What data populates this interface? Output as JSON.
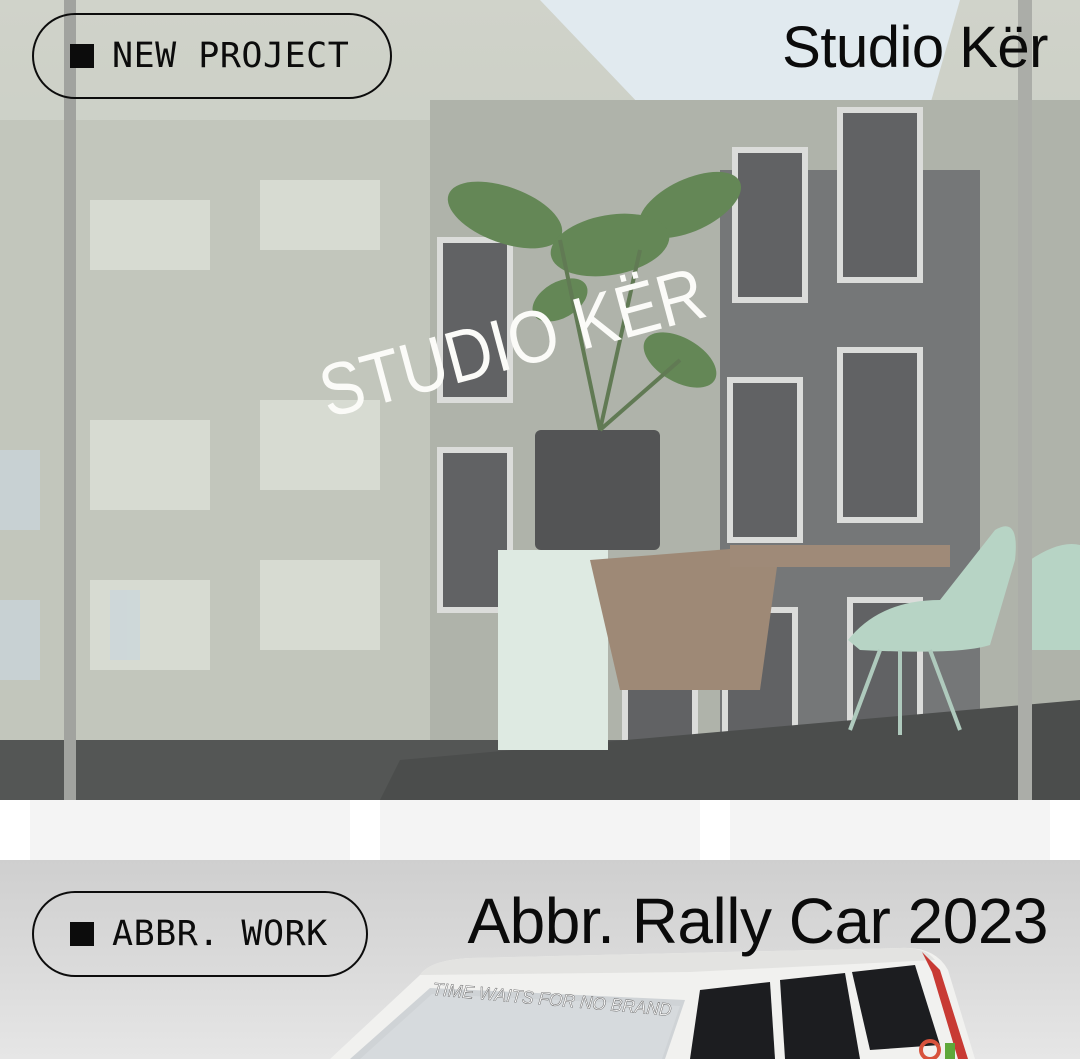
{
  "hero": {
    "cta_label": "NEW PROJECT",
    "brand": "Studio Kër",
    "window_sign": "STUDIO KËR",
    "image": "storefront-window-photo"
  },
  "project": {
    "category_label": "ABBR. WORK",
    "title": "Abbr. Rally Car 2023",
    "car_slogan": "TIME WAITS FOR NO BRAND",
    "image": "rally-car-photo"
  },
  "colors": {
    "ink": "#0c0c0c",
    "page_bg": "#ffffff",
    "glass": "#c3c7bd",
    "plant": "#3f6b2f",
    "chair": "#a9cdbd"
  },
  "icons": [
    "square-bullet-icon"
  ]
}
